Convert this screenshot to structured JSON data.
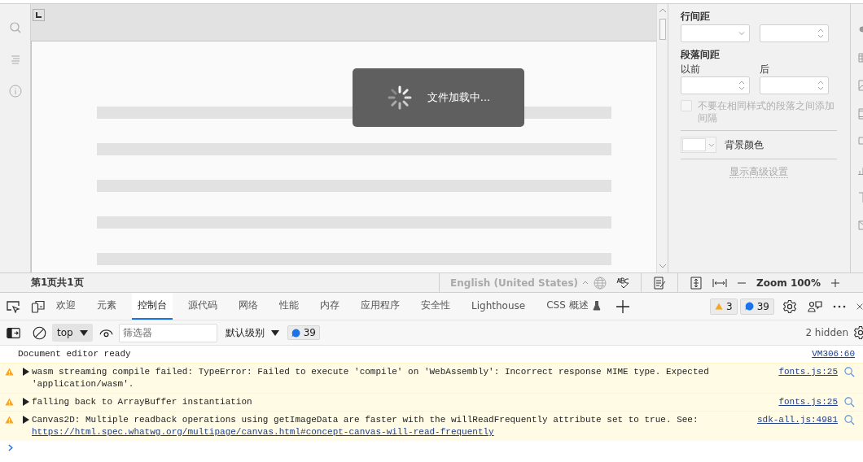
{
  "editor": {
    "loading_text": "文件加载中...",
    "paragraph_panel": {
      "line_spacing_heading": "行间距",
      "paragraph_spacing_heading": "段落间距",
      "before_label": "以前",
      "after_label": "后",
      "no_space_checkbox": {
        "label": "不要在相同样式的段落之间添加间隔",
        "checked": false,
        "disabled": true
      },
      "background_color_label": "背景颜色",
      "advanced_link": "显示高级设置"
    }
  },
  "status_bar": {
    "page_info": "第1页共1页",
    "language": "English (United States)",
    "zoom": "Zoom 100%"
  },
  "devtools": {
    "tabs": [
      {
        "label": "欢迎",
        "selected": false
      },
      {
        "label": "元素",
        "selected": false
      },
      {
        "label": "控制台",
        "selected": true
      },
      {
        "label": "源代码",
        "selected": false
      },
      {
        "label": "网络",
        "selected": false
      },
      {
        "label": "性能",
        "selected": false
      },
      {
        "label": "内存",
        "selected": false
      },
      {
        "label": "应用程序",
        "selected": false
      },
      {
        "label": "安全性",
        "selected": false
      },
      {
        "label": "Lighthouse",
        "selected": false
      },
      {
        "label": "CSS 概述",
        "selected": false,
        "experimental": true
      }
    ],
    "warnings_count": "3",
    "messages_count": "39"
  },
  "console_toolbar": {
    "context": "top",
    "filter_placeholder": "筛选器",
    "level": "默认级别",
    "messages_count": "39",
    "hidden": "2 hidden"
  },
  "console": {
    "messages": [
      {
        "kind": "log",
        "text": "Document editor ready",
        "source": "VM306:60"
      },
      {
        "kind": "warning",
        "text": "wasm streaming compile failed: TypeError: Failed to execute 'compile' on 'WebAssembly': Incorrect response MIME type. Expected 'application/wasm'.",
        "source": "fonts.js:25"
      },
      {
        "kind": "warning",
        "text": "falling back to ArrayBuffer instantiation",
        "source": "fonts.js:25"
      },
      {
        "kind": "warning",
        "text": "Canvas2D: Multiple readback operations using getImageData are faster with the willReadFrequently attribute set to true. See:",
        "link": "https://html.spec.whatwg.org/multipage/canvas.html#concept-canvas-will-read-frequently",
        "source": "sdk-all.js:4981"
      }
    ]
  }
}
